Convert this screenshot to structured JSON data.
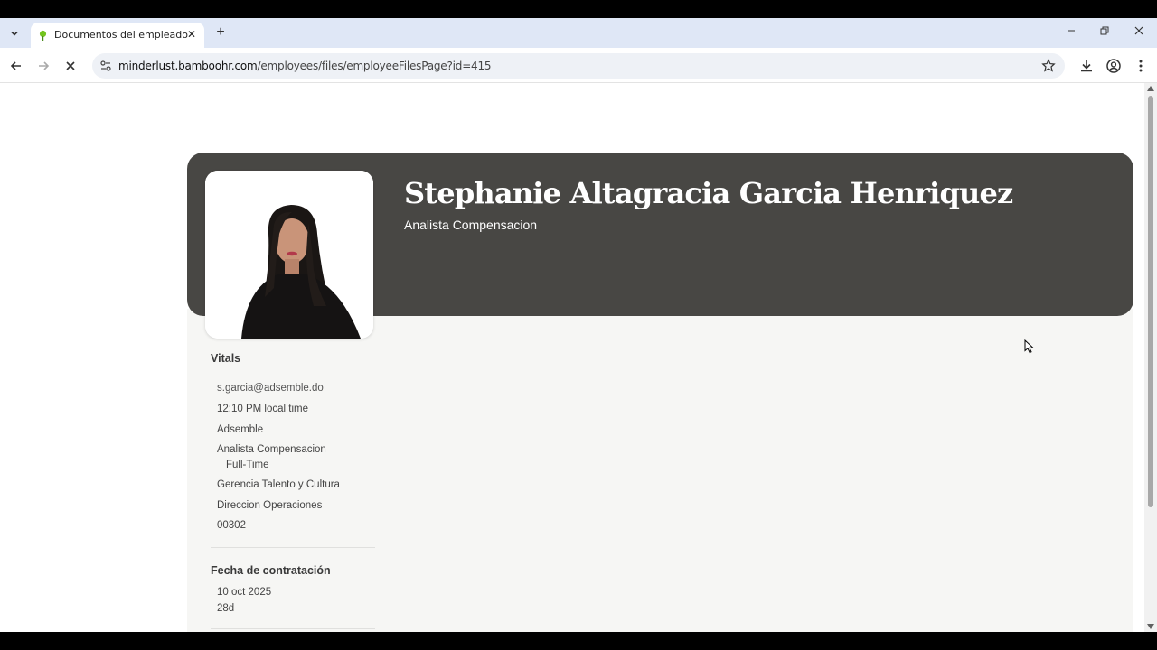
{
  "browser": {
    "tab_title": "Documentos del empleado",
    "url_host": "minderlust.bamboohr.com",
    "url_path": "/employees/files/employeeFilesPage?id=415"
  },
  "employee": {
    "name": "Stephanie Altagracia Garcia Henriquez",
    "job_title": "Analista Compensacion"
  },
  "vitals": {
    "heading": "Vitals",
    "email": "s.garcia@adsemble.do",
    "local_time": "12:10 PM local time",
    "company": "Adsemble",
    "position": "Analista Compensacion",
    "employment_type": "Full-Time",
    "department": "Gerencia Talento y Cultura",
    "division": "Direccion Operaciones",
    "employee_number": "00302"
  },
  "hire": {
    "heading": "Fecha de contratación",
    "date": "10 oct 2025",
    "tenure": "28d"
  },
  "colors": {
    "header_bg": "#484744",
    "tabstrip_bg": "#dfe7f6",
    "brand_green": "#73c41d"
  }
}
